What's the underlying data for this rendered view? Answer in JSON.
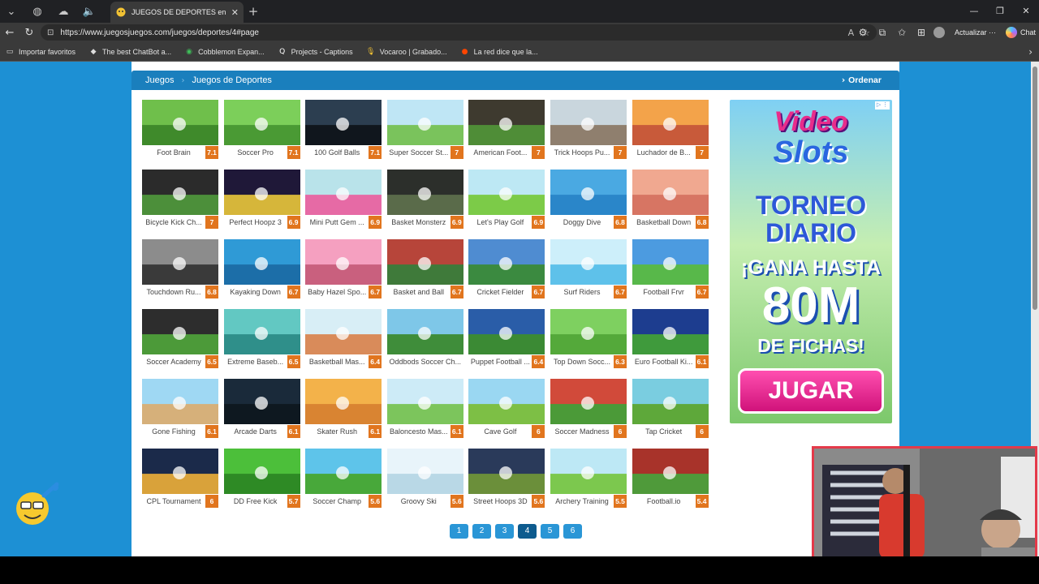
{
  "browser": {
    "tab_title": "JUEGOS DE DEPORTES en Juegos...",
    "url": "https://www.juegosjuegos.com/juegos/deportes/4#page",
    "update_label": "Actualizar",
    "chat_label": "Chat",
    "bookmarks": [
      {
        "label": "Importar favoritos",
        "icon": "folder-icon"
      },
      {
        "label": "The best ChatBot a...",
        "icon": "chatbot-icon"
      },
      {
        "label": "Cobblemon Expan...",
        "icon": "cobblemon-icon"
      },
      {
        "label": "Projects - Captions",
        "icon": "captions-icon"
      },
      {
        "label": "Vocaroo | Grabado...",
        "icon": "vocaroo-icon"
      },
      {
        "label": "La red dice que la...",
        "icon": "reddit-icon"
      }
    ]
  },
  "breadcrumb": {
    "home": "Juegos",
    "current": "Juegos de Deportes",
    "order_label": "Ordenar"
  },
  "games": [
    {
      "name": "Foot Brain",
      "score": "7.1",
      "colors": [
        "#6fbf4b",
        "#3f8a2b"
      ]
    },
    {
      "name": "Soccer Pro",
      "score": "7.1",
      "colors": [
        "#7ccf5a",
        "#4a9a34"
      ]
    },
    {
      "name": "100 Golf Balls",
      "score": "7.1",
      "colors": [
        "#2c3e50",
        "#10161d"
      ]
    },
    {
      "name": "Super Soccer St...",
      "score": "7",
      "colors": [
        "#bfe6f5",
        "#7ac35c"
      ]
    },
    {
      "name": "American Foot...",
      "score": "7",
      "colors": [
        "#3e3a2f",
        "#4f8d37"
      ]
    },
    {
      "name": "Trick Hoops Pu...",
      "score": "7",
      "colors": [
        "#c9d6dd",
        "#8f7f6e"
      ]
    },
    {
      "name": "Luchador de B...",
      "score": "7",
      "colors": [
        "#f3a34a",
        "#c85a3a"
      ]
    },
    {
      "name": "Bicycle Kick Ch...",
      "score": "7",
      "colors": [
        "#2b2b2b",
        "#4c8f3a"
      ]
    },
    {
      "name": "Perfect Hoopz 3",
      "score": "6.9",
      "colors": [
        "#1f1838",
        "#d6b63a"
      ]
    },
    {
      "name": "Mini Putt Gem ...",
      "score": "6.9",
      "colors": [
        "#b9e3ea",
        "#e66aa5"
      ]
    },
    {
      "name": "Basket Monsterz",
      "score": "6.9",
      "colors": [
        "#2c2f2b",
        "#5a6b4a"
      ]
    },
    {
      "name": "Let's Play Golf",
      "score": "6.9",
      "colors": [
        "#bde8f4",
        "#7ccb48"
      ]
    },
    {
      "name": "Doggy Dive",
      "score": "6.8",
      "colors": [
        "#4aa9e2",
        "#2a86c9"
      ]
    },
    {
      "name": "Basketball Down",
      "score": "6.8",
      "colors": [
        "#f0a890",
        "#d77563"
      ]
    },
    {
      "name": "Touchdown Ru...",
      "score": "6.8",
      "colors": [
        "#8c8c8c",
        "#3a3a3a"
      ]
    },
    {
      "name": "Kayaking Down",
      "score": "6.7",
      "colors": [
        "#2f9ad6",
        "#1c6ea8"
      ]
    },
    {
      "name": "Baby Hazel Spo...",
      "score": "6.7",
      "colors": [
        "#f5a0c0",
        "#c9607e"
      ]
    },
    {
      "name": "Basket and Ball",
      "score": "6.7",
      "colors": [
        "#b7453a",
        "#3f7a3a"
      ]
    },
    {
      "name": "Cricket Fielder",
      "score": "6.7",
      "colors": [
        "#4f8cd1",
        "#3b8a40"
      ]
    },
    {
      "name": "Surf Riders",
      "score": "6.7",
      "colors": [
        "#cdeffa",
        "#5ec1ea"
      ]
    },
    {
      "name": "Football Frvr",
      "score": "6.7",
      "colors": [
        "#4c9be0",
        "#58b84a"
      ]
    },
    {
      "name": "Soccer Academy",
      "score": "6.5",
      "colors": [
        "#2d2d2d",
        "#4c9a39"
      ]
    },
    {
      "name": "Extreme Baseb...",
      "score": "6.5",
      "colors": [
        "#62c8c2",
        "#2f8f8a"
      ]
    },
    {
      "name": "Basketball Mas...",
      "score": "6.4",
      "colors": [
        "#d8eef6",
        "#d98b5a"
      ]
    },
    {
      "name": "Oddbods Soccer Ch...",
      "score": "",
      "colors": [
        "#7ec7e8",
        "#3f8d3a"
      ]
    },
    {
      "name": "Puppet Football ...",
      "score": "6.4",
      "colors": [
        "#2a5da8",
        "#3b8a34"
      ]
    },
    {
      "name": "Top Down Socc...",
      "score": "6.3",
      "colors": [
        "#7ed060",
        "#54a93a"
      ]
    },
    {
      "name": "Euro Football Ki...",
      "score": "6.1",
      "colors": [
        "#1d3d8f",
        "#3f9a3c"
      ]
    },
    {
      "name": "Gone Fishing",
      "score": "6.1",
      "colors": [
        "#9fd8f3",
        "#d6b07a"
      ]
    },
    {
      "name": "Arcade Darts",
      "score": "6.1",
      "colors": [
        "#1a2a3a",
        "#0e1820"
      ]
    },
    {
      "name": "Skater Rush",
      "score": "6.1",
      "colors": [
        "#f3b24a",
        "#d98432"
      ]
    },
    {
      "name": "Baloncesto Mas...",
      "score": "6.1",
      "colors": [
        "#cdebf7",
        "#7cc55c"
      ]
    },
    {
      "name": "Cave Golf",
      "score": "6",
      "colors": [
        "#9ad7f2",
        "#7dbf45"
      ]
    },
    {
      "name": "Soccer Madness",
      "score": "6",
      "colors": [
        "#d14a3a",
        "#4b9a38"
      ]
    },
    {
      "name": "Tap Cricket",
      "score": "6",
      "colors": [
        "#7acde0",
        "#5ea83a"
      ]
    },
    {
      "name": "CPL Tournament",
      "score": "6",
      "colors": [
        "#1b2a4a",
        "#d9a23a"
      ]
    },
    {
      "name": "DD Free Kick",
      "score": "5.7",
      "colors": [
        "#4cbf3a",
        "#2e8a25"
      ]
    },
    {
      "name": "Soccer Champ",
      "score": "5.6",
      "colors": [
        "#5ec4ea",
        "#48a83a"
      ]
    },
    {
      "name": "Groovy Ski",
      "score": "5.6",
      "colors": [
        "#e8f4fa",
        "#b9d8e6"
      ]
    },
    {
      "name": "Street Hoops 3D",
      "score": "5.6",
      "colors": [
        "#2a3a5a",
        "#6b8f3a"
      ]
    },
    {
      "name": "Archery Training",
      "score": "5.5",
      "colors": [
        "#bde8f5",
        "#7cc84e"
      ]
    },
    {
      "name": "Football.io",
      "score": "5.4",
      "colors": [
        "#a8332a",
        "#4f9a3a"
      ]
    }
  ],
  "pagination": [
    "1",
    "2",
    "3",
    "4",
    "5",
    "6"
  ],
  "active_page": "4",
  "ad": {
    "line1": "Video",
    "line2": "Slots",
    "line3": "TORNEO",
    "line4": "DIARIO",
    "line5": "¡GANA HASTA",
    "line6": "80M",
    "line7": "DE FICHAS!",
    "cta": "JUGAR"
  },
  "colors": {
    "page_bg": "#1d90d4",
    "header_bar": "#1a7fbd",
    "score_badge": "#e1751e",
    "page_btn": "#2a96d6",
    "page_btn_active": "#0d5b8e"
  }
}
